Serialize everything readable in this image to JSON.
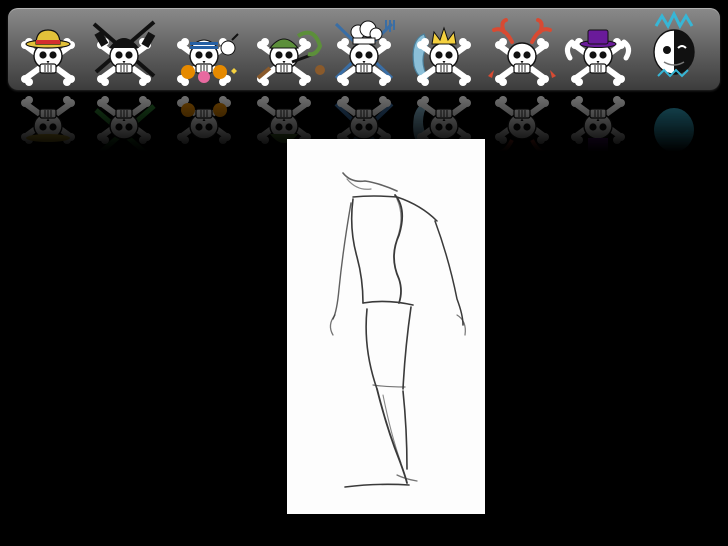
{
  "slide": {
    "background_color": "#000000",
    "banner_color": "#6f6f6f"
  },
  "jolly_rogers": [
    {
      "name": "straw-hat-skull-icon",
      "accent": "#e2c13a"
    },
    {
      "name": "bandana-swords-skull-icon",
      "accent": "#2e7d32"
    },
    {
      "name": "goggles-nose-skull-icon",
      "accent": "#e68a00"
    },
    {
      "name": "bandana-nose-skull-icon",
      "accent": "#5c8f3a"
    },
    {
      "name": "chef-hat-skull-icon",
      "accent": "#3a6ea5"
    },
    {
      "name": "tiara-skull-icon",
      "accent": "#8bbfd8"
    },
    {
      "name": "antler-skull-icon",
      "accent": "#d84a32"
    },
    {
      "name": "top-hat-skull-icon",
      "accent": "#6a1b9a"
    },
    {
      "name": "split-face-skull-icon",
      "accent": "#37b6d6"
    }
  ],
  "sketch": {
    "subject": "stick-figure-walking-sketch-icon",
    "paper_color": "#fdfdfd",
    "line_color": "#3a3a3a"
  }
}
